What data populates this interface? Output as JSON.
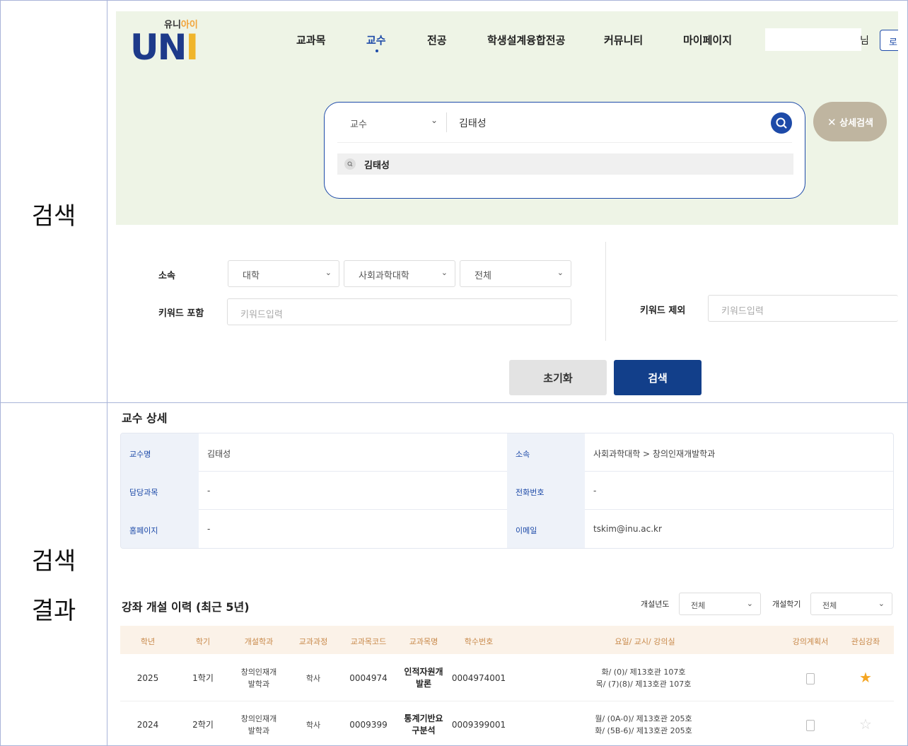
{
  "labels": {
    "top": "검색",
    "bottom_line1": "검색",
    "bottom_line2": "결과"
  },
  "brand": {
    "small_a": "유니",
    "small_b": "아이",
    "big_a": "UN",
    "big_b": "I"
  },
  "nav": [
    {
      "label": "교과목"
    },
    {
      "label": "교수",
      "active": true
    },
    {
      "label": "전공"
    },
    {
      "label": "학생설계융합전공"
    },
    {
      "label": "커뮤니티"
    },
    {
      "label": "마이페이지"
    }
  ],
  "user": {
    "suffix": "님",
    "button": "로"
  },
  "search": {
    "category": "교수",
    "query": "김태성",
    "suggestion": "김태성",
    "advanced_label": "상세검색"
  },
  "form": {
    "affiliation_label": "소속",
    "affiliation_1": "대학",
    "affiliation_2": "사회과학대학",
    "affiliation_3": "전체",
    "keyword_include_label": "키워드 포함",
    "keyword_include_placeholder": "키워드입력",
    "keyword_exclude_label": "키워드 제외",
    "keyword_exclude_placeholder": "키워드입력",
    "reset_label": "초기화",
    "search_label": "검색"
  },
  "detail": {
    "title": "교수 상세",
    "name_key": "교수명",
    "name_val": "김태성",
    "dept_key": "소속",
    "dept_val": "사회과학대학 > 창의인재개발학과",
    "courses_key": "담당과목",
    "courses_val": "-",
    "phone_key": "전화번호",
    "phone_val": "-",
    "homepage_key": "홈페이지",
    "homepage_val": "-",
    "email_key": "이메일",
    "email_val": "tskim@inu.ac.kr"
  },
  "history": {
    "title": "강좌 개설 이력 (최근 5년)",
    "year_filter_label": "개설년도",
    "year_filter_value": "전체",
    "term_filter_label": "개설학기",
    "term_filter_value": "전체",
    "columns": [
      "학년",
      "학기",
      "개설학과",
      "교과과정",
      "교과목코드",
      "교과목명",
      "학수번호",
      "요일/ 교시/ 강의실",
      "강의계획서",
      "관심강좌"
    ],
    "rows": [
      {
        "year": "2025",
        "term": "1학기",
        "dept_1": "창의인재개",
        "dept_2": "발학과",
        "program": "학사",
        "code": "0004974",
        "name_1": "인적자원개",
        "name_2": "발론",
        "course_no": "0004974001",
        "time_1": "화/ (0)/ 제13호관 107호",
        "time_2": "목/ (7)(8)/ 제13호관 107호",
        "favorite": true
      },
      {
        "year": "2024",
        "term": "2학기",
        "dept_1": "창의인재개",
        "dept_2": "발학과",
        "program": "학사",
        "code": "0009399",
        "name_1": "통계기반요",
        "name_2": "구분석",
        "course_no": "0009399001",
        "time_1": "월/ (0A-0)/ 제13호관 205호",
        "time_2": "화/ (5B-6)/ 제13호관 205호",
        "favorite": false
      }
    ]
  },
  "colors": {
    "accent": "#1d4aa8",
    "primary_button": "#123f8a",
    "star": "#f5a623",
    "hero_bg": "#eef4e6"
  }
}
